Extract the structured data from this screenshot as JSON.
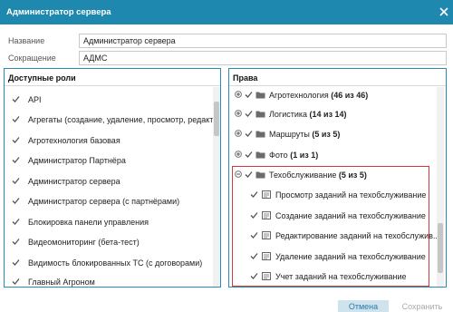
{
  "dialog": {
    "title": "Администратор сервера"
  },
  "form": {
    "name_label": "Название",
    "name_value": "Администратор сервера",
    "short_label": "Сокращение",
    "short_value": "АДМС"
  },
  "roles": {
    "header": "Доступные роли",
    "items": [
      "API",
      "Агрегаты (создание, удаление, просмотр, редакт...",
      "Агротехнология базовая",
      "Администратор Партнёра",
      "Администратор сервера",
      "Администратор сервера (с партнёрами)",
      "Блокировка панели управления",
      "Видеомониторинг (бета-тест)",
      "Видимость блокированных ТС (с договорами)",
      "Главный Агроном"
    ]
  },
  "rights": {
    "header": "Права",
    "groups": [
      {
        "label": "Агротехнология",
        "count": "(46 из 46)"
      },
      {
        "label": "Логистика",
        "count": "(14 из 14)"
      },
      {
        "label": "Маршруты",
        "count": "(5 из 5)"
      },
      {
        "label": "Фото",
        "count": "(1 из 1)"
      },
      {
        "label": "Техобслуживание",
        "count": "(5 из 5)"
      }
    ],
    "children": [
      "Просмотр заданий на техобслуживание",
      "Создание заданий на техобслуживание",
      "Редактирование заданий на техобслужив...",
      "Удаление заданий на техобслуживание",
      "Учет заданий на техобслуживание"
    ]
  },
  "buttons": {
    "cancel": "Отмена",
    "save": "Сохранить"
  },
  "colors": {
    "titlebar": "#1e88ae",
    "panel_border": "#2a8cb4",
    "highlight": "#d9363e"
  }
}
